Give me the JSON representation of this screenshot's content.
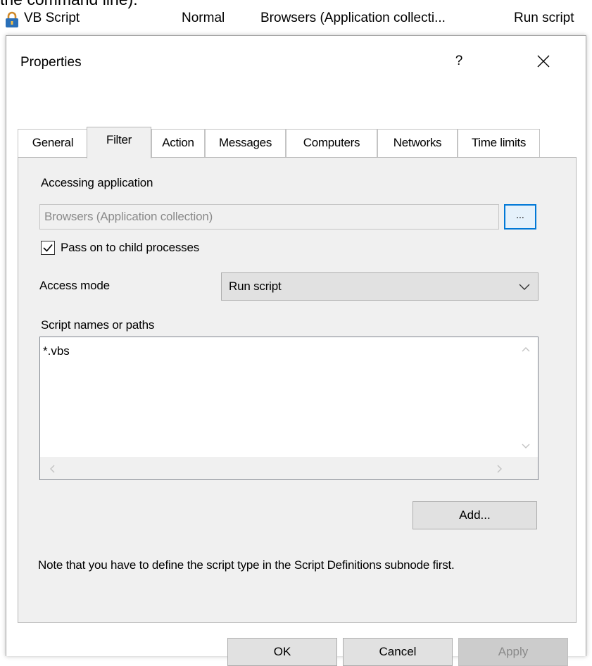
{
  "top_line": "the command line).",
  "rule": {
    "name": "VB Script",
    "priority": "Normal",
    "application": "Browsers (Application collecti...",
    "action": "Run script"
  },
  "dialog": {
    "title": "Properties",
    "help": "?",
    "tabs": [
      {
        "label": "General"
      },
      {
        "label": "Filter"
      },
      {
        "label": "Action"
      },
      {
        "label": "Messages"
      },
      {
        "label": "Computers"
      },
      {
        "label": "Networks"
      },
      {
        "label": "Time limits"
      }
    ],
    "active_tab": "Filter",
    "filter": {
      "accessing_application_label": "Accessing application",
      "accessing_application_value": "Browsers (Application collection)",
      "browse_label": "...",
      "pass_on_label": "Pass on to child processes",
      "pass_on_checked": true,
      "access_mode_label": "Access mode",
      "access_mode_value": "Run script",
      "script_names_label": "Script names or paths",
      "script_names": [
        "*.vbs"
      ],
      "add_label": "Add...",
      "note": "Note that you have to define the script type in the Script Definitions subnode first."
    },
    "buttons": {
      "ok": "OK",
      "cancel": "Cancel",
      "apply": "Apply"
    }
  }
}
